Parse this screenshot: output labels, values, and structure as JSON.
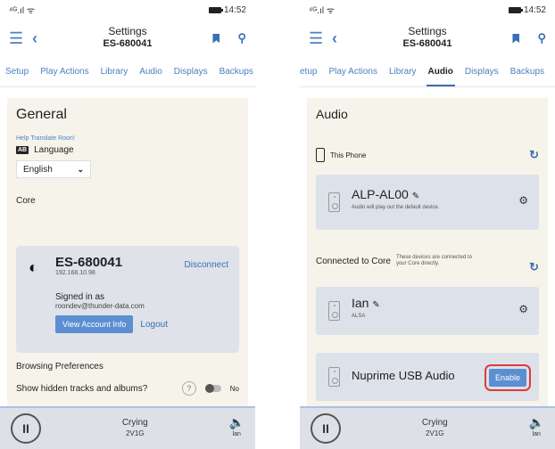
{
  "left": {
    "status": {
      "signal": "⁴ᴳ.ıl ᯤ",
      "time": "14:52"
    },
    "header": {
      "title": "Settings",
      "subtitle": "ES-680041"
    },
    "tabs": [
      "Setup",
      "Play Actions",
      "Library",
      "Audio",
      "Displays",
      "Backups"
    ],
    "general": {
      "heading": "General",
      "help_link": "Help Translate Roon!",
      "language_label": "Language",
      "language_icon": "AB",
      "language_value": "English"
    },
    "core": {
      "label": "Core",
      "name": "ES-680041",
      "ip": "192.168.10.98",
      "disconnect": "Disconnect",
      "signed_in": "Signed in as",
      "email": "roondev@thunder-data.com",
      "view_account": "View Account Info",
      "logout": "Logout"
    },
    "browsing": {
      "label": "Browsing Preferences",
      "hidden_tracks": "Show hidden tracks and albums?",
      "help_icon": "?",
      "toggle_value": "No"
    },
    "player": {
      "track": "Crying",
      "subtitle": "2V1G",
      "volume_label": "lan"
    }
  },
  "right": {
    "status": {
      "signal": "⁴ᴳ.ıl ᯤ",
      "time": "14:52"
    },
    "header": {
      "title": "Settings",
      "subtitle": "ES-680041"
    },
    "tabs": [
      "etup",
      "Play Actions",
      "Library",
      "Audio",
      "Displays",
      "Backups"
    ],
    "active_tab": "Audio",
    "audio": {
      "heading": "Audio",
      "this_phone": "This Phone",
      "alp_name": "ALP-AL00",
      "alp_note": "Audio will play out the default device.",
      "connected_label": "Connected to Core",
      "connected_note": "These devices are connected to your Core directly.",
      "ian_name": "Ian",
      "ian_sub": "ALSA",
      "nuprime_name": "Nuprime USB Audio",
      "enable": "Enable"
    },
    "player": {
      "track": "Crying",
      "subtitle": "2V1G",
      "volume_label": "lan"
    }
  }
}
